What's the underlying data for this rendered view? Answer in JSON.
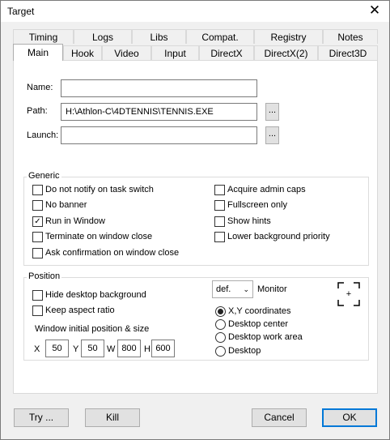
{
  "window": {
    "title": "Target",
    "close_glyph": "✕"
  },
  "tabs_row1": [
    "Timing",
    "Logs",
    "Libs",
    "Compat.",
    "Registry",
    "Notes"
  ],
  "tabs_row2": [
    "Main",
    "Hook",
    "Video",
    "Input",
    "DirectX",
    "DirectX(2)",
    "Direct3D"
  ],
  "active_tab": "Main",
  "fields": {
    "name": {
      "label": "Name:",
      "value": ""
    },
    "path": {
      "label": "Path:",
      "value": "H:\\Athlon-C\\4DTENNIS\\TENNIS.EXE"
    },
    "launch": {
      "label": "Launch:",
      "value": ""
    },
    "browse_label": "..."
  },
  "generic": {
    "title": "Generic",
    "left": [
      {
        "label": "Do not notify on task switch",
        "checked": false
      },
      {
        "label": "No banner",
        "checked": false
      },
      {
        "label": "Run in Window",
        "checked": true
      },
      {
        "label": "Terminate on window close",
        "checked": false
      },
      {
        "label": "Ask confirmation on window close",
        "checked": false
      }
    ],
    "right": [
      {
        "label": "Acquire admin caps",
        "checked": false
      },
      {
        "label": "Fullscreen only",
        "checked": false
      },
      {
        "label": "Show hints",
        "checked": false
      },
      {
        "label": "Lower background priority",
        "checked": false
      }
    ]
  },
  "position": {
    "title": "Position",
    "checks": [
      {
        "label": "Hide desktop background",
        "checked": false
      },
      {
        "label": "Keep aspect ratio",
        "checked": false
      }
    ],
    "monitor_select": "def.",
    "monitor_label": "Monitor",
    "center_glyph": "+",
    "init_label": "Window initial position & size",
    "coords": [
      {
        "label": "X",
        "value": "50"
      },
      {
        "label": "Y",
        "value": "50"
      },
      {
        "label": "W",
        "value": "800"
      },
      {
        "label": "H",
        "value": "600"
      }
    ],
    "radios": [
      {
        "label": "X,Y coordinates",
        "checked": true
      },
      {
        "label": "Desktop center",
        "checked": false
      },
      {
        "label": "Desktop work area",
        "checked": false
      },
      {
        "label": "Desktop",
        "checked": false
      }
    ]
  },
  "buttons": {
    "try": "Try ...",
    "kill": "Kill",
    "cancel": "Cancel",
    "ok": "OK"
  }
}
